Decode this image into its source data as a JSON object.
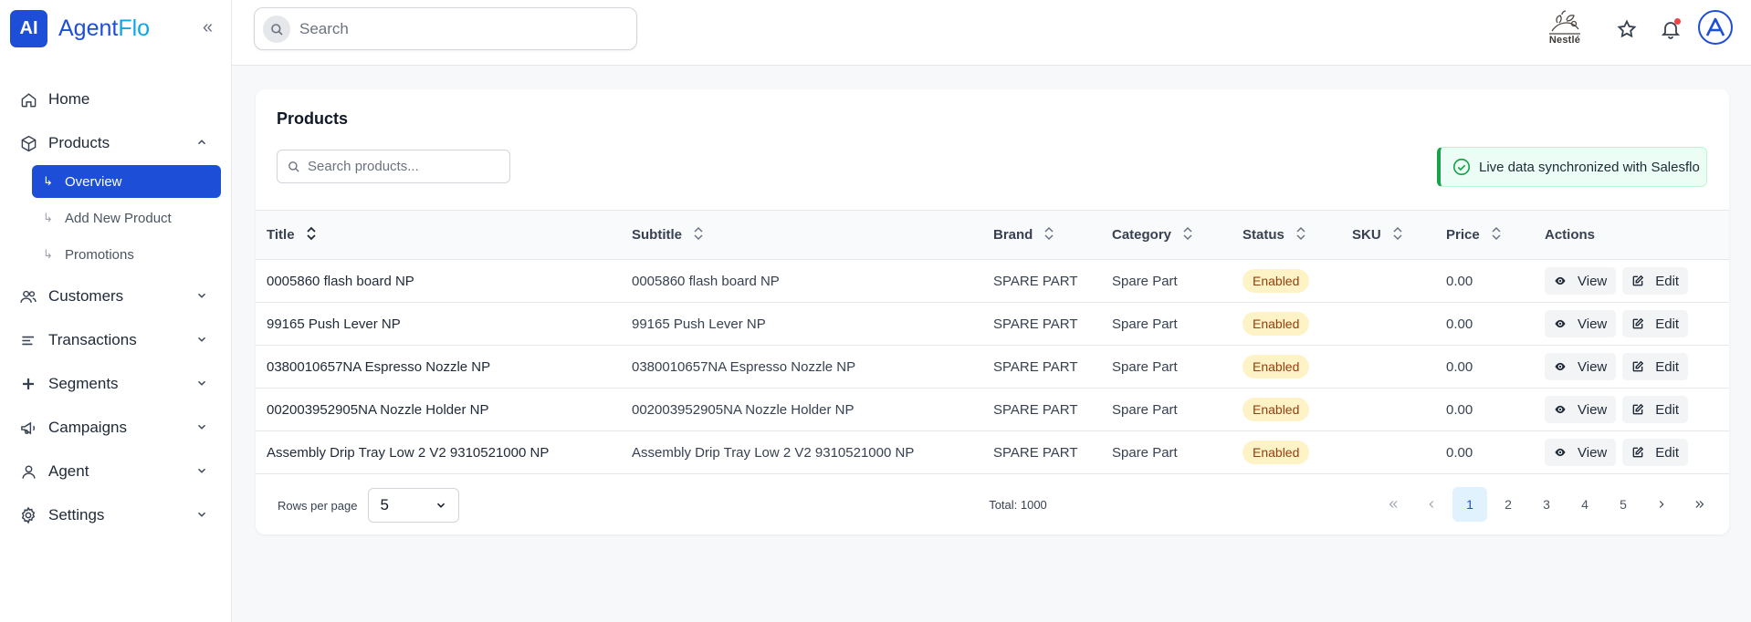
{
  "brand": {
    "logo": "AI",
    "name_part1": "Agent",
    "name_part2": "Flo"
  },
  "sidebar": {
    "items": [
      {
        "label": "Home",
        "icon": "home-icon"
      },
      {
        "label": "Products",
        "icon": "box-icon",
        "expanded": true
      },
      {
        "label": "Customers",
        "icon": "users-icon"
      },
      {
        "label": "Transactions",
        "icon": "list-icon"
      },
      {
        "label": "Segments",
        "icon": "plus-icon"
      },
      {
        "label": "Campaigns",
        "icon": "megaphone-icon"
      },
      {
        "label": "Agent",
        "icon": "user-icon"
      },
      {
        "label": "Settings",
        "icon": "gear-icon"
      }
    ],
    "sub_items": [
      {
        "label": "Overview",
        "active": true
      },
      {
        "label": "Add New Product"
      },
      {
        "label": "Promotions"
      }
    ]
  },
  "topbar": {
    "search_placeholder": "Search",
    "partner_logo_text": "Nestlé"
  },
  "page": {
    "title": "Products",
    "search_placeholder": "Search products...",
    "sync_message": "Live data synchronized with Salesflo"
  },
  "table": {
    "columns": [
      "Title",
      "Subtitle",
      "Brand",
      "Category",
      "Status",
      "SKU",
      "Price",
      "Actions"
    ],
    "rows": [
      {
        "title": "0005860 flash board NP",
        "subtitle": "0005860 flash board NP",
        "brand": "SPARE PART",
        "category": "Spare Part",
        "status": "Enabled",
        "sku": "",
        "price": "0.00"
      },
      {
        "title": "99165 Push Lever NP",
        "subtitle": "99165 Push Lever NP",
        "brand": "SPARE PART",
        "category": "Spare Part",
        "status": "Enabled",
        "sku": "",
        "price": "0.00"
      },
      {
        "title": "0380010657NA Espresso Nozzle NP",
        "subtitle": "0380010657NA Espresso Nozzle NP",
        "brand": "SPARE PART",
        "category": "Spare Part",
        "status": "Enabled",
        "sku": "",
        "price": "0.00"
      },
      {
        "title": "002003952905NA Nozzle Holder NP",
        "subtitle": "002003952905NA Nozzle Holder NP",
        "brand": "SPARE PART",
        "category": "Spare Part",
        "status": "Enabled",
        "sku": "",
        "price": "0.00"
      },
      {
        "title": "Assembly Drip Tray Low 2 V2 9310521000 NP",
        "subtitle": "Assembly Drip Tray Low 2 V2 9310521000 NP",
        "brand": "SPARE PART",
        "category": "Spare Part",
        "status": "Enabled",
        "sku": "",
        "price": "0.00"
      }
    ],
    "view_label": "View",
    "edit_label": "Edit"
  },
  "footer": {
    "rows_per_page_label": "Rows per page",
    "rows_per_page_value": "5",
    "total": "Total: 1000",
    "pages": [
      "1",
      "2",
      "3",
      "4",
      "5"
    ],
    "current_page": "1"
  },
  "colors": {
    "primary": "#1d4ed8",
    "accent": "#0ea5e9",
    "badge_bg": "#fef3c7",
    "badge_text": "#92400e",
    "success": "#16a34a"
  }
}
